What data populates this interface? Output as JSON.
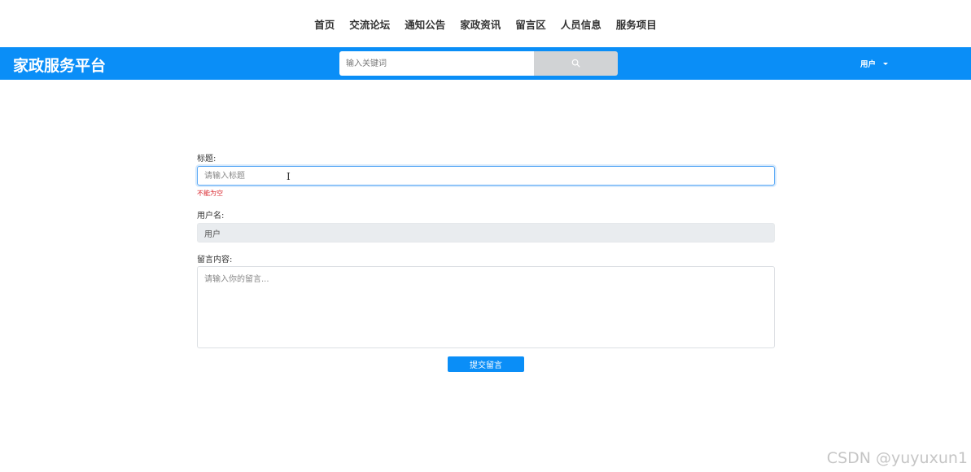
{
  "top_nav": {
    "items": [
      "首页",
      "交流论坛",
      "通知公告",
      "家政资讯",
      "留言区",
      "人员信息",
      "服务项目"
    ]
  },
  "header": {
    "brand": "家政服务平台",
    "search": {
      "placeholder": "输入关键词",
      "button_icon": "search-icon"
    },
    "user_menu": {
      "label": "用户",
      "icon": "caret-down-icon"
    },
    "accent_color": "#0a8ef7"
  },
  "form": {
    "title_label": "标题:",
    "title_placeholder": "请输入标题",
    "title_error": "不能为空",
    "username_label": "用户名:",
    "username_value": "用户",
    "content_label": "留言内容:",
    "content_placeholder": "请输入你的留言...",
    "submit_label": "提交留言"
  },
  "watermark": "CSDN @yuyuxun1"
}
